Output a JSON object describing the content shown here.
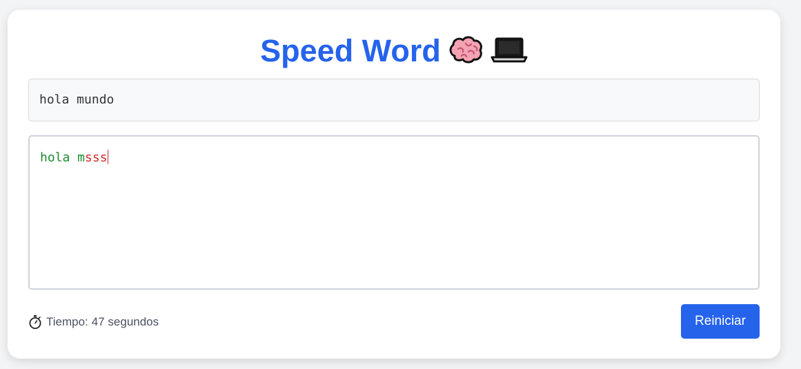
{
  "header": {
    "title": "Speed Word",
    "emojis": [
      "brain-icon",
      "laptop-icon"
    ]
  },
  "target": {
    "text": "hola mundo"
  },
  "typing": {
    "correct_text": "hola m",
    "incorrect_text": "sss"
  },
  "timer": {
    "label": "Tiempo:",
    "value": "47 segundos"
  },
  "controls": {
    "restart_label": "Reiniciar"
  },
  "colors": {
    "accent": "#2563eb",
    "correct": "#1c8a2e",
    "incorrect": "#d42a2a"
  }
}
